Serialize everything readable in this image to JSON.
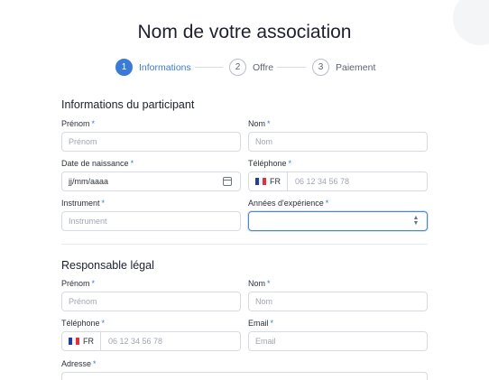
{
  "page_title": "Nom de votre association",
  "steps": [
    {
      "num": "1",
      "label": "Informations"
    },
    {
      "num": "2",
      "label": "Offre"
    },
    {
      "num": "3",
      "label": "Paiement"
    }
  ],
  "participant": {
    "section_title": "Informations du participant",
    "prenom_label": "Prénom",
    "prenom_placeholder": "Prénom",
    "nom_label": "Nom",
    "nom_placeholder": "Nom",
    "dob_label": "Date de naissance",
    "dob_value": "jj/mm/aaaa",
    "tel_label": "Téléphone",
    "tel_country": "FR",
    "tel_placeholder": "06 12 34 56 78",
    "instrument_label": "Instrument",
    "instrument_placeholder": "Instrument",
    "experience_label": "Années d'expérience"
  },
  "legal": {
    "section_title": "Responsable légal",
    "prenom_label": "Prénom",
    "prenom_placeholder": "Prénom",
    "nom_label": "Nom",
    "nom_placeholder": "Nom",
    "tel_label": "Téléphone",
    "tel_country": "FR",
    "tel_placeholder": "06 12 34 56 78",
    "email_label": "Email",
    "email_placeholder": "Email",
    "address_label": "Adresse"
  },
  "required_mark": "*",
  "icons": {
    "calendar": "calendar-icon",
    "select": "chevron-up-down-icon",
    "flag": "flag-fr-icon"
  },
  "colors": {
    "accent": "#3a7bd5"
  }
}
